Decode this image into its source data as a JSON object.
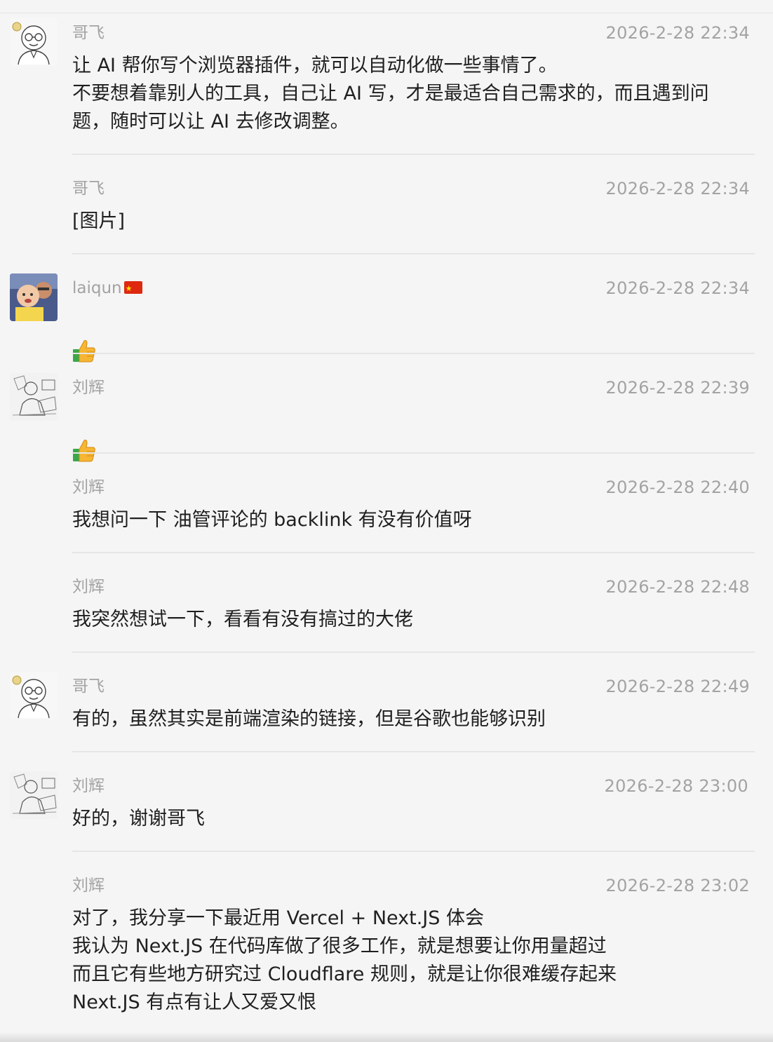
{
  "messages": [
    {
      "sender": "哥飞",
      "time": "2026-2-28 22:34",
      "text": "让 AI 帮你写个浏览器插件，就可以自动化做一些事情了。\n不要想着靠别人的工具，自己让 AI 写，才是最适合自己需求的，而且遇到问题，随时可以让 AI 去修改调整。",
      "avatar": "gefei-avatar"
    },
    {
      "sender": "哥飞",
      "time": "2026-2-28 22:34",
      "text": "[图片]",
      "avatar": ""
    },
    {
      "sender": "laiqun",
      "time": "2026-2-28 22:34",
      "text": "",
      "avatar": "laiqun-avatar",
      "flag_icon": "china-flag-icon",
      "emoji": "thumbs-up-icon"
    },
    {
      "sender": "刘辉",
      "time": "2026-2-28 22:39",
      "text": "",
      "avatar": "liuhui-avatar",
      "emoji": "thumbs-up-icon"
    },
    {
      "sender": "刘辉",
      "time": "2026-2-28 22:40",
      "text": "我想问一下 油管评论的 backlink 有没有价值呀",
      "avatar": ""
    },
    {
      "sender": "刘辉",
      "time": "2026-2-28 22:48",
      "text": "我突然想试一下，看看有没有搞过的大佬",
      "avatar": ""
    },
    {
      "sender": "哥飞",
      "time": "2026-2-28 22:49",
      "text": "有的，虽然其实是前端渲染的链接，但是谷歌也能够识别",
      "avatar": "gefei-avatar"
    },
    {
      "sender": "刘辉",
      "time": "2026-2-28 23:00",
      "text": "好的，谢谢哥飞",
      "avatar": "liuhui-avatar"
    },
    {
      "sender": "刘辉",
      "time": "2026-2-28 23:02",
      "text": "对了，我分享一下最近用 Vercel + Next.JS 体会\n 我认为 Next.JS 在代码库做了很多工作，就是想要让你用量超过\n 而且它有些地方研究过 Cloudflare 规则，就是让你很难缓存起来\n Next.JS 有点有让人又爱又恨",
      "avatar": ""
    }
  ],
  "colors": {
    "background": "#f5f5f5",
    "meta_text": "#a3a3a3",
    "body_text": "#1f1f1f",
    "separator": "#e6e6e6"
  }
}
